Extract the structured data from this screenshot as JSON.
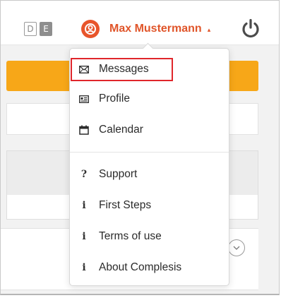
{
  "header": {
    "languages": [
      "D",
      "E"
    ],
    "active_language": "E",
    "user_name": "Max Mustermann",
    "caret": "▴",
    "icons": {
      "avatar": "user-circle-icon",
      "power": "power-icon"
    }
  },
  "menu": {
    "items": [
      {
        "label": "Messages",
        "icon": "envelope-icon",
        "glyph": ""
      },
      {
        "label": "Profile",
        "icon": "id-card-icon",
        "glyph": ""
      },
      {
        "label": "Calendar",
        "icon": "calendar-icon",
        "glyph": ""
      },
      {
        "label": "Support",
        "icon": "question-icon",
        "glyph": "?"
      },
      {
        "label": "First Steps",
        "icon": "info-icon",
        "glyph": "i"
      },
      {
        "label": "Terms of use",
        "icon": "info-icon",
        "glyph": "i"
      },
      {
        "label": "About Complesis",
        "icon": "info-icon",
        "glyph": "i"
      }
    ],
    "highlighted_item": "Messages"
  },
  "colors": {
    "accent": "#e0552a",
    "banner": "#f7a718",
    "highlight_border": "#e0262b"
  }
}
